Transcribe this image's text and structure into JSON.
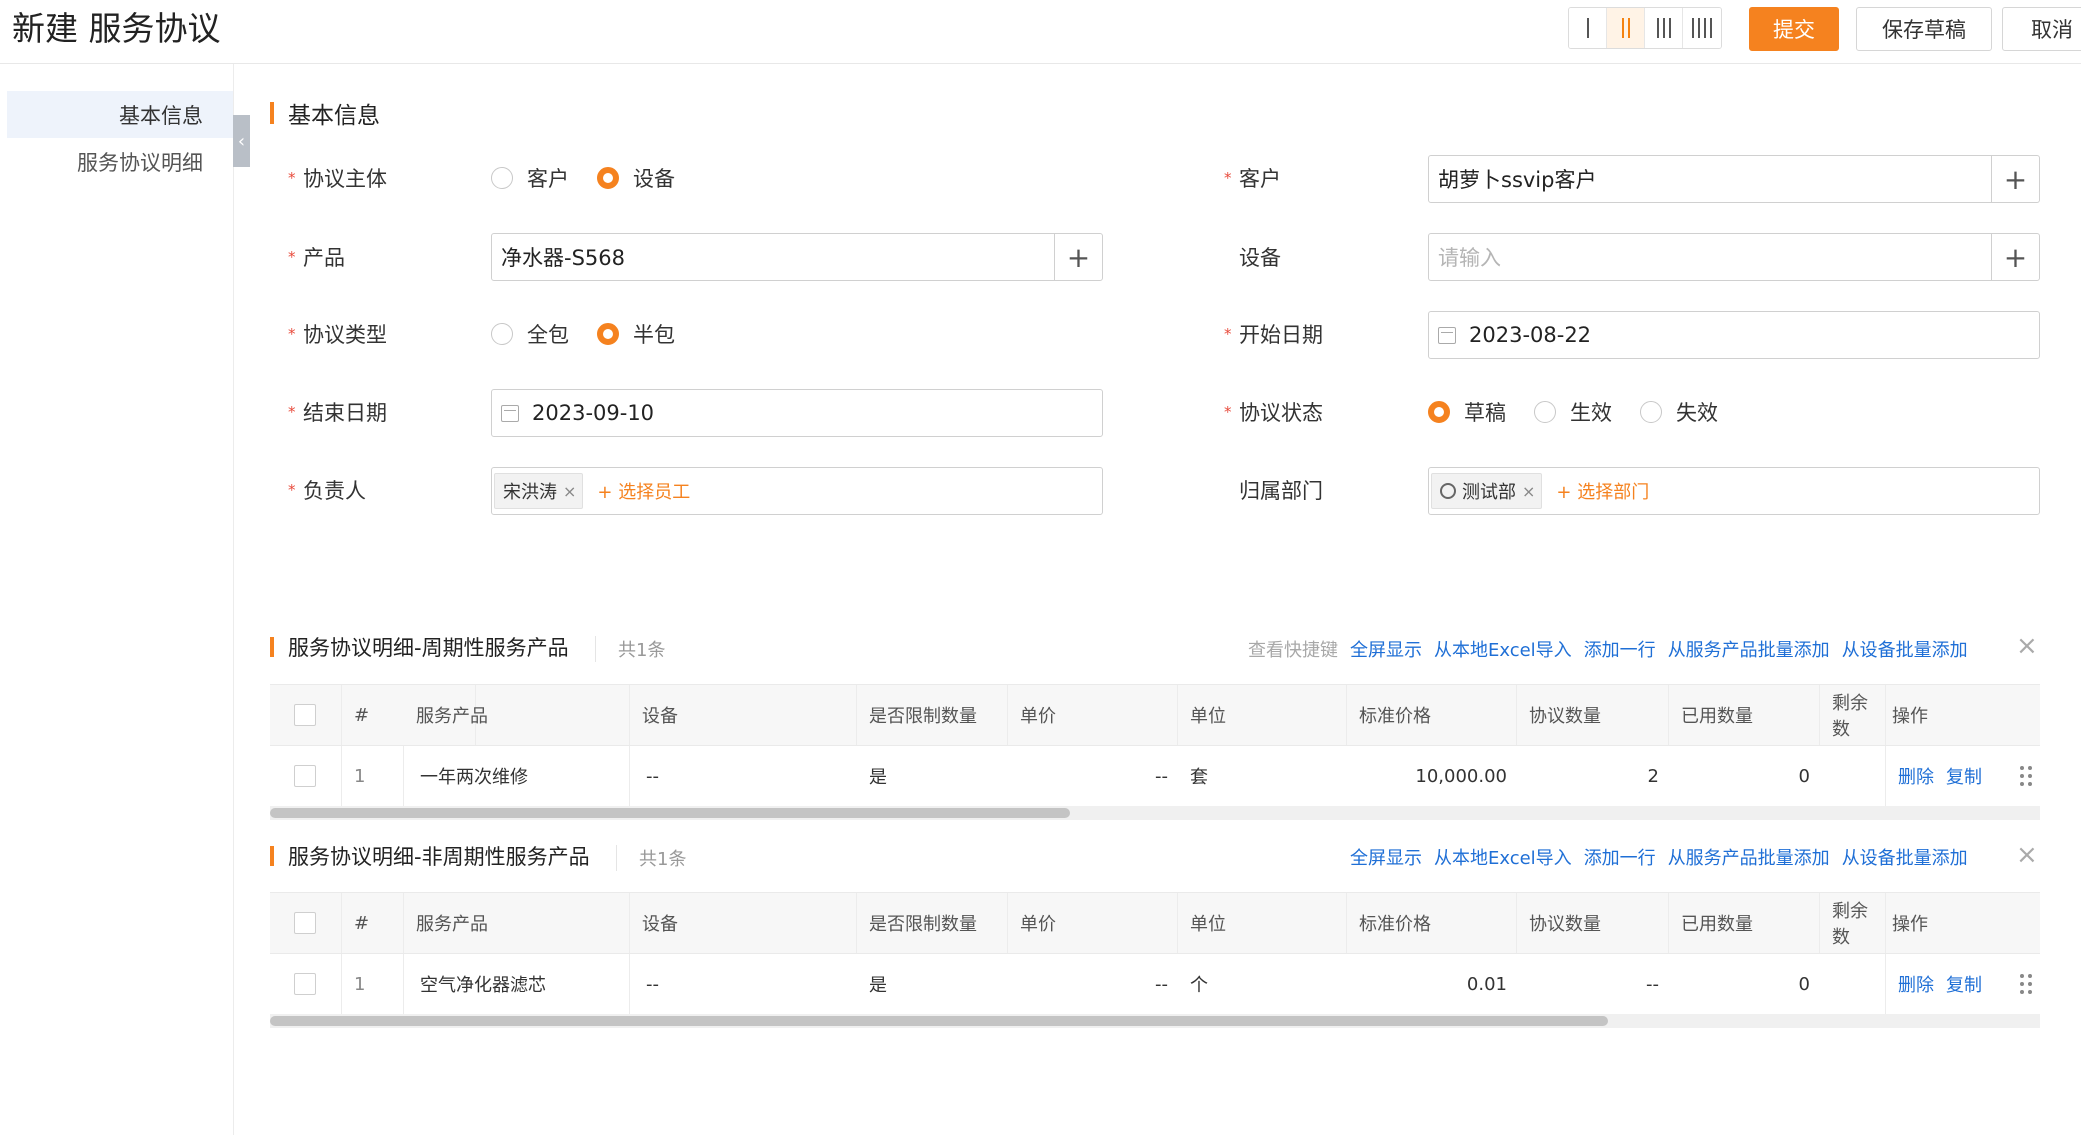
{
  "header": {
    "title": "新建 服务协议",
    "layout_options": [
      "I",
      "II",
      "III",
      "IIII"
    ],
    "active_layout": "II",
    "submit_label": "提交",
    "save_draft_label": "保存草稿",
    "cancel_label": "取消"
  },
  "sidebar": {
    "items": [
      {
        "label": "基本信息",
        "active": true
      },
      {
        "label": "服务协议明细",
        "active": false
      }
    ]
  },
  "basic": {
    "title": "基本信息",
    "subject": {
      "label": "协议主体",
      "options": [
        "客户",
        "设备"
      ],
      "selected": "设备"
    },
    "customer": {
      "label": "客户",
      "value": "胡萝卜ssvip客户"
    },
    "product": {
      "label": "产品",
      "value": "净水器-S568"
    },
    "device": {
      "label": "设备",
      "placeholder": "请输入"
    },
    "type": {
      "label": "协议类型",
      "options": [
        "全包",
        "半包"
      ],
      "selected": "半包"
    },
    "start_date": {
      "label": "开始日期",
      "value": "2023-08-22"
    },
    "end_date": {
      "label": "结束日期",
      "value": "2023-09-10"
    },
    "status": {
      "label": "协议状态",
      "options": [
        "草稿",
        "生效",
        "失效"
      ],
      "selected": "草稿"
    },
    "owner": {
      "label": "负责人",
      "tag": "宋洪涛",
      "add": "+ 选择员工"
    },
    "department": {
      "label": "归属部门",
      "tag": "测试部",
      "add": "+ 选择部门"
    }
  },
  "table_periodic": {
    "title": "服务协议明细-周期性服务产品",
    "count": "共1条",
    "links": [
      "查看快捷键",
      "全屏显示",
      "从本地Excel导入",
      "添加一行",
      "从服务产品批量添加",
      "从设备批量添加"
    ],
    "columns": [
      "#",
      "服务产品",
      "设备",
      "是否限制数量",
      "单价",
      "单位",
      "标准价格",
      "协议数量",
      "已用数量",
      "剩余数",
      "操作"
    ],
    "rows": [
      {
        "index": "1",
        "product": "一年两次维修",
        "device": "--",
        "limit": "是",
        "price": "--",
        "unit": "套",
        "std_price": "10,000.00",
        "qty": "2",
        "used": "0",
        "remain": "",
        "op_delete": "删除",
        "op_copy": "复制"
      }
    ]
  },
  "table_nonperiodic": {
    "title": "服务协议明细-非周期性服务产品",
    "count": "共1条",
    "links": [
      "全屏显示",
      "从本地Excel导入",
      "添加一行",
      "从服务产品批量添加",
      "从设备批量添加"
    ],
    "columns": [
      "#",
      "服务产品",
      "设备",
      "是否限制数量",
      "单价",
      "单位",
      "标准价格",
      "协议数量",
      "已用数量",
      "剩余数",
      "操作"
    ],
    "rows": [
      {
        "index": "1",
        "product": "空气净化器滤芯",
        "device": "--",
        "limit": "是",
        "price": "--",
        "unit": "个",
        "std_price": "0.01",
        "qty": "--",
        "used": "0",
        "remain": "",
        "op_delete": "删除",
        "op_copy": "复制"
      }
    ]
  },
  "colors": {
    "accent": "#f5821f",
    "link": "#1f6fd6",
    "required": "#e84c3d"
  }
}
